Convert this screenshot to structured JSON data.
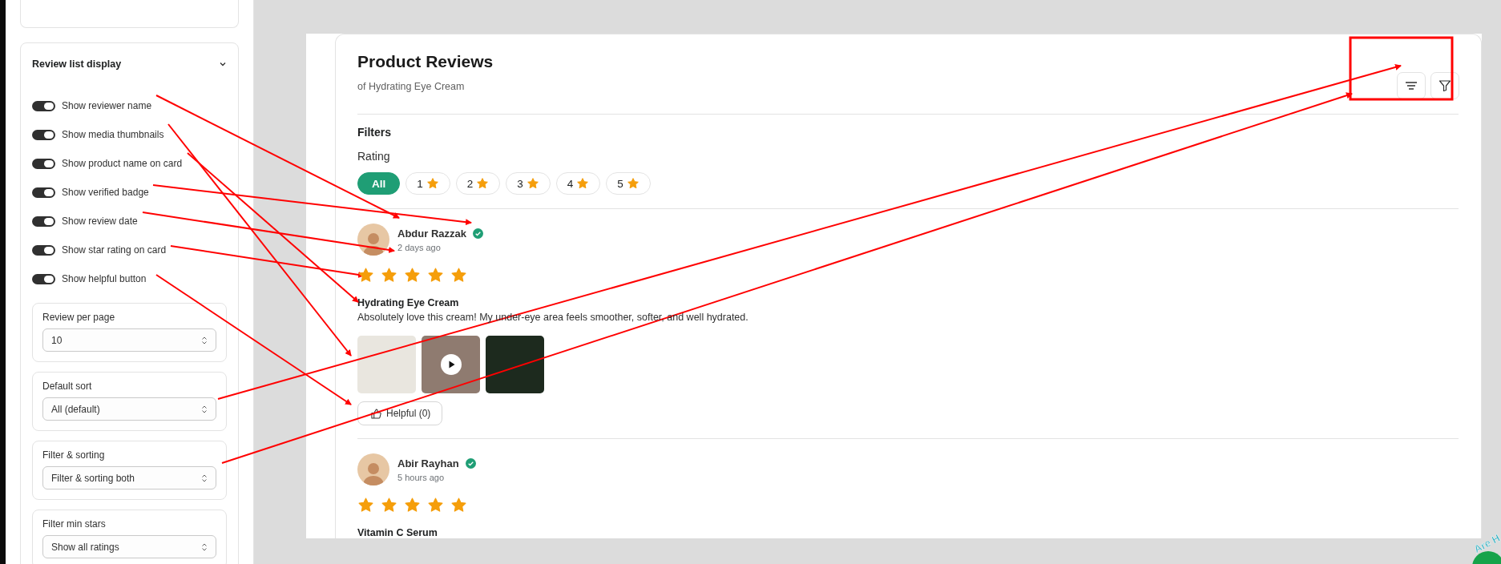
{
  "sidebar": {
    "section": {
      "title": "Review list display",
      "expanded": true,
      "toggles": [
        {
          "label": "Show reviewer name",
          "on": true
        },
        {
          "label": "Show media thumbnails",
          "on": true
        },
        {
          "label": "Show product name on card",
          "on": true
        },
        {
          "label": "Show verified badge",
          "on": true
        },
        {
          "label": "Show review date",
          "on": true
        },
        {
          "label": "Show star rating on card",
          "on": true
        },
        {
          "label": "Show helpful button",
          "on": true
        }
      ],
      "selects": [
        {
          "label": "Review per page",
          "value": "10"
        },
        {
          "label": "Default sort",
          "value": "All (default)"
        },
        {
          "label": "Filter & sorting",
          "value": "Filter & sorting both"
        },
        {
          "label": "Filter min stars",
          "value": "Show all ratings"
        }
      ]
    }
  },
  "preview": {
    "title": "Product Reviews",
    "subtitle": "of Hydrating Eye Cream",
    "filters": {
      "heading": "Filters",
      "rating_label": "Rating",
      "chips": [
        {
          "label": "All",
          "star": false,
          "selected": true
        },
        {
          "label": "1",
          "star": true,
          "selected": false
        },
        {
          "label": "2",
          "star": true,
          "selected": false
        },
        {
          "label": "3",
          "star": true,
          "selected": false
        },
        {
          "label": "4",
          "star": true,
          "selected": false
        },
        {
          "label": "5",
          "star": true,
          "selected": false
        }
      ]
    },
    "reviews": [
      {
        "name": "Abdur Razzak",
        "verified": true,
        "date": "2 days ago",
        "stars": 5,
        "product": "Hydrating Eye Cream",
        "text": "Absolutely love this cream! My under-eye area feels smoother, softer, and well hydrated.",
        "media": [
          {
            "kind": "image"
          },
          {
            "kind": "video"
          },
          {
            "kind": "image"
          }
        ],
        "helpful": "Helpful (0)"
      },
      {
        "name": "Abir Rayhan",
        "verified": true,
        "date": "5 hours ago",
        "stars": 5,
        "product": "Vitamin C Serum"
      }
    ]
  },
  "chat_badge": {
    "text": "Are H"
  }
}
